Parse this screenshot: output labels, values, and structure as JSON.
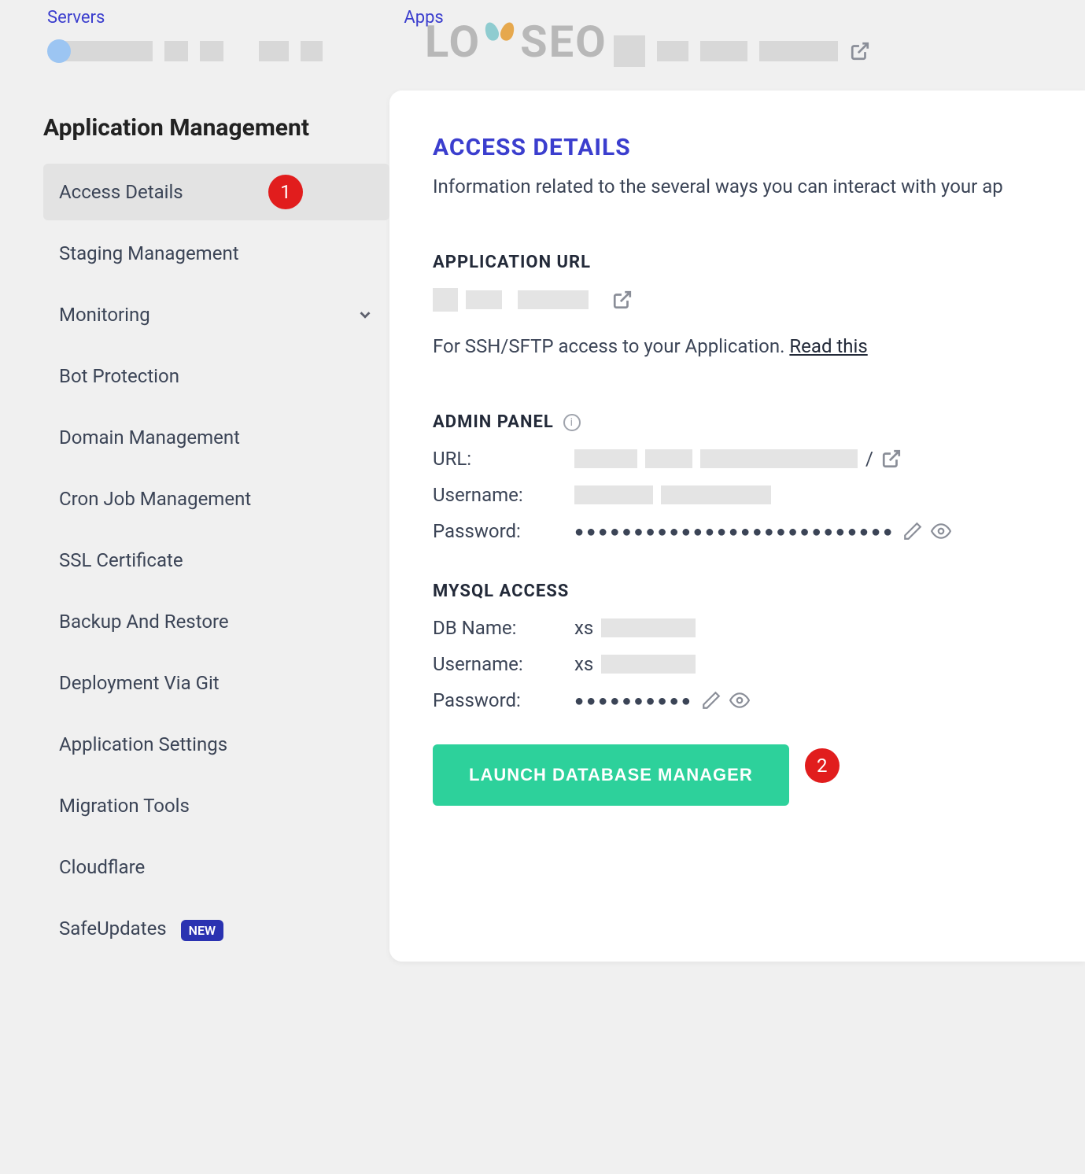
{
  "topnav": {
    "servers": "Servers",
    "apps": "Apps"
  },
  "watermark": "LO SEO",
  "sidebar": {
    "heading": "Application Management",
    "items": [
      {
        "label": "Access Details",
        "active": true
      },
      {
        "label": "Staging Management"
      },
      {
        "label": "Monitoring",
        "expandable": true
      },
      {
        "label": "Bot Protection"
      },
      {
        "label": "Domain Management"
      },
      {
        "label": "Cron Job Management"
      },
      {
        "label": "SSL Certificate"
      },
      {
        "label": "Backup And Restore"
      },
      {
        "label": "Deployment Via Git"
      },
      {
        "label": "Application Settings"
      },
      {
        "label": "Migration Tools"
      },
      {
        "label": "Cloudflare"
      },
      {
        "label": "SafeUpdates",
        "badge": "NEW"
      }
    ]
  },
  "annotations": {
    "one": "1",
    "two": "2"
  },
  "main": {
    "title": "ACCESS DETAILS",
    "subtitle": "Information related to the several ways you can interact with your ap",
    "app_url_heading": "APPLICATION URL",
    "helper_text": "For SSH/SFTP access to your Application. ",
    "helper_link": "Read this",
    "admin_panel_heading": "ADMIN PANEL",
    "admin": {
      "url_label": "URL:",
      "url_suffix": "/",
      "username_label": "Username:",
      "password_label": "Password:",
      "password_mask": "●●●●●●●●●●●●●●●●●●●●●●●●●●●"
    },
    "mysql_heading": "MYSQL ACCESS",
    "mysql": {
      "dbname_label": "DB Name:",
      "dbname_prefix": "xs",
      "username_label": "Username:",
      "username_prefix": "xs",
      "password_label": "Password:",
      "password_mask": "●●●●●●●●●●"
    },
    "launch_button": "LAUNCH DATABASE MANAGER"
  }
}
